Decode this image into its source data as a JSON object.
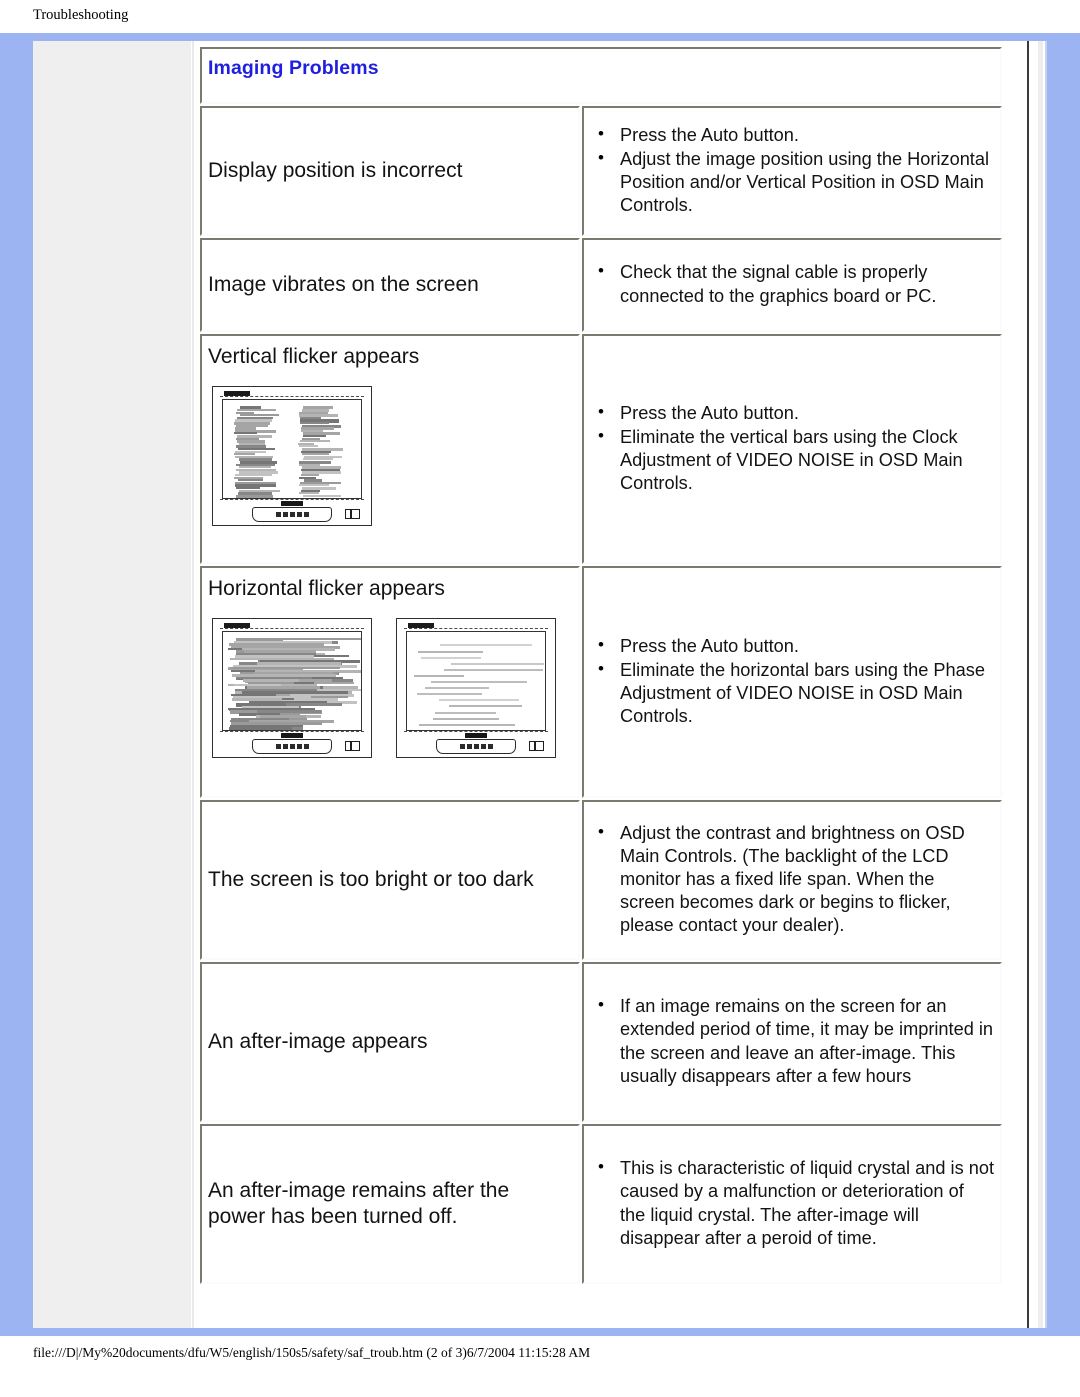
{
  "page": {
    "header_title": "Troubleshooting",
    "footer_path": "file:///D|/My%20documents/dfu/W5/english/150s5/safety/saf_troub.htm (2 of 3)6/7/2004 11:15:28 AM",
    "accent_color": "#1f1fdd",
    "frame_color": "#9db4f2",
    "nav_color": "#efefef"
  },
  "section": {
    "title": "Imaging Problems"
  },
  "rows": [
    {
      "label": "Display position is incorrect",
      "bullets": [
        "Press the Auto button.",
        "Adjust the image position using the Horizontal Position and/or Vertical Position in OSD Main Controls."
      ],
      "images": []
    },
    {
      "label": "Image vibrates on the screen",
      "bullets": [
        "Check that the signal cable is properly connected to the graphics board or PC."
      ],
      "images": []
    },
    {
      "label": "Vertical flicker appears",
      "bullets": [
        "Press the Auto button.",
        "Eliminate the vertical bars using the Clock Adjustment of VIDEO NOISE in OSD Main Controls."
      ],
      "images": [
        "monitor-vertical-noise"
      ]
    },
    {
      "label": "Horizontal flicker appears",
      "bullets": [
        "Press the Auto button.",
        "Eliminate the horizontal bars using the Phase Adjustment of VIDEO NOISE in OSD Main Controls."
      ],
      "images": [
        "monitor-horizontal-noise-heavy",
        "monitor-horizontal-noise-light"
      ]
    },
    {
      "label": "The screen is too bright or too dark",
      "bullets": [
        "Adjust the contrast and brightness on OSD Main Controls. (The backlight of the LCD monitor has a fixed life span. When the screen becomes dark or begins to flicker, please contact your dealer)."
      ],
      "images": []
    },
    {
      "label": "An after-image appears",
      "bullets": [
        "If an image remains on the screen for an extended period of time, it may be imprinted in the screen and leave an after-image. This usually disappears after a few hours"
      ],
      "images": []
    },
    {
      "label": "An after-image remains after the power has been turned off.",
      "bullets": [
        "This is characteristic of liquid crystal and is not caused by a malfunction or deterioration of the liquid crystal. The after-image will disappear after a peroid of time."
      ],
      "images": []
    }
  ]
}
